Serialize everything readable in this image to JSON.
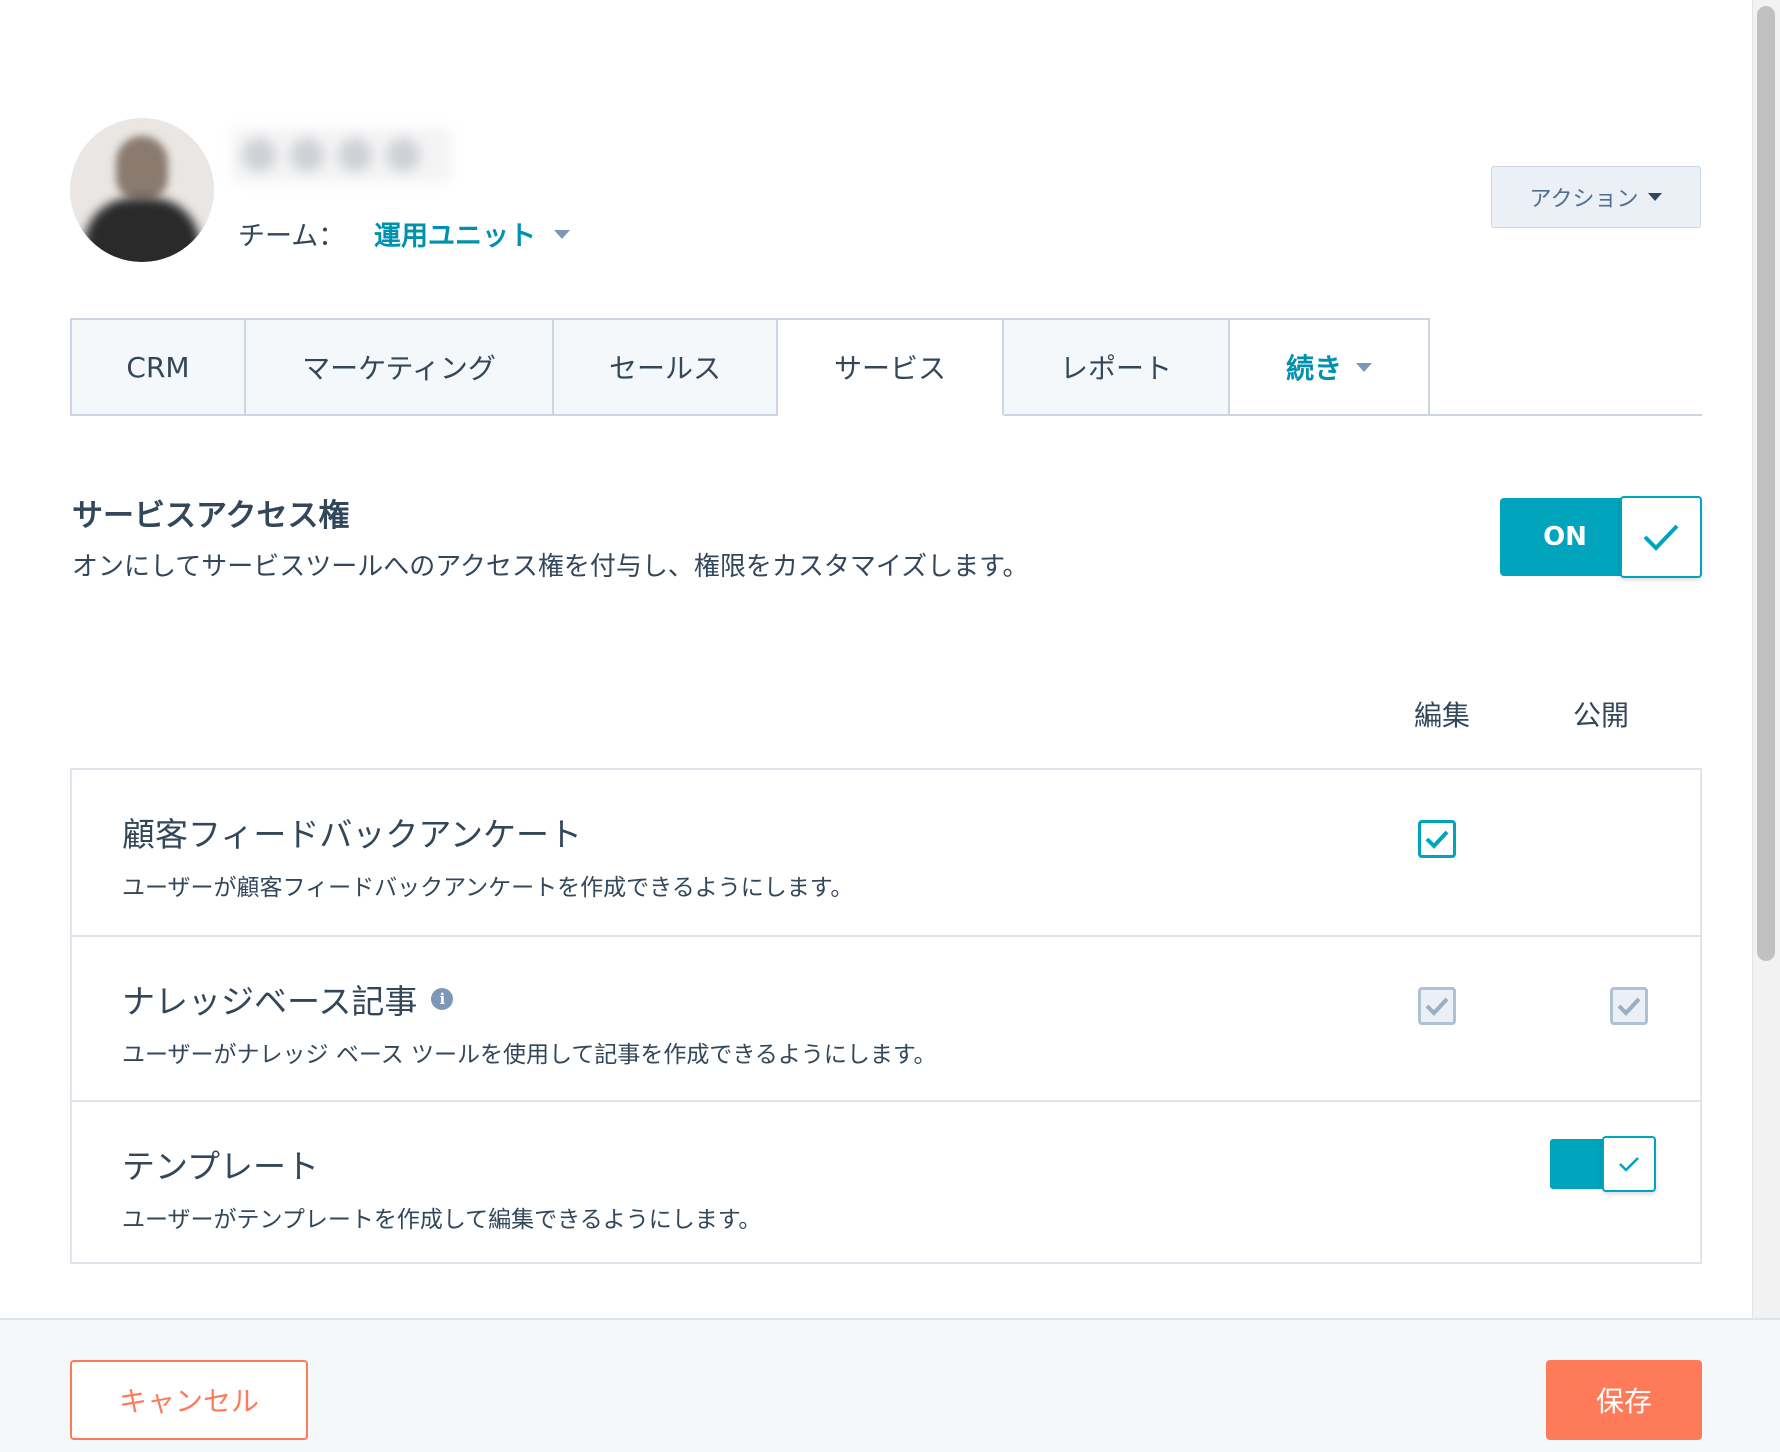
{
  "header": {
    "team_label": "チーム：",
    "team_value": "運用ユニット",
    "action_button": "アクション"
  },
  "tabs": [
    {
      "label": "CRM",
      "active": false
    },
    {
      "label": "マーケティング",
      "active": false
    },
    {
      "label": "セールス",
      "active": false
    },
    {
      "label": "サービス",
      "active": true
    },
    {
      "label": "レポート",
      "active": false
    },
    {
      "label": "続き",
      "active": false
    }
  ],
  "access": {
    "title": "サービスアクセス権",
    "description": "オンにしてサービスツールへのアクセス権を付与し、権限をカスタマイズします。",
    "toggle_label": "ON",
    "enabled": true
  },
  "columns": {
    "edit": "編集",
    "publish": "公開"
  },
  "permissions": [
    {
      "title": "顧客フィードバックアンケート",
      "description": "ユーザーが顧客フィードバックアンケートを作成できるようにします。",
      "edit": {
        "checked": true,
        "disabled": false
      },
      "publish": null
    },
    {
      "title": "ナレッジベース記事",
      "description": "ユーザーがナレッジ ベース ツールを使用して記事を作成できるようにします。",
      "info_icon": "info-icon",
      "edit": {
        "checked": true,
        "disabled": true
      },
      "publish": {
        "checked": true,
        "disabled": true
      }
    },
    {
      "title": "テンプレート",
      "description": "ユーザーがテンプレートを作成して編集できるようにします。",
      "toggle": {
        "on": true
      }
    }
  ],
  "footer": {
    "cancel": "キャンセル",
    "save": "保存"
  },
  "colors": {
    "accent": "#00a4bd",
    "link": "#0091ae",
    "primary_action": "#ff7a59",
    "text": "#33475b",
    "border": "#cbd6e2"
  }
}
